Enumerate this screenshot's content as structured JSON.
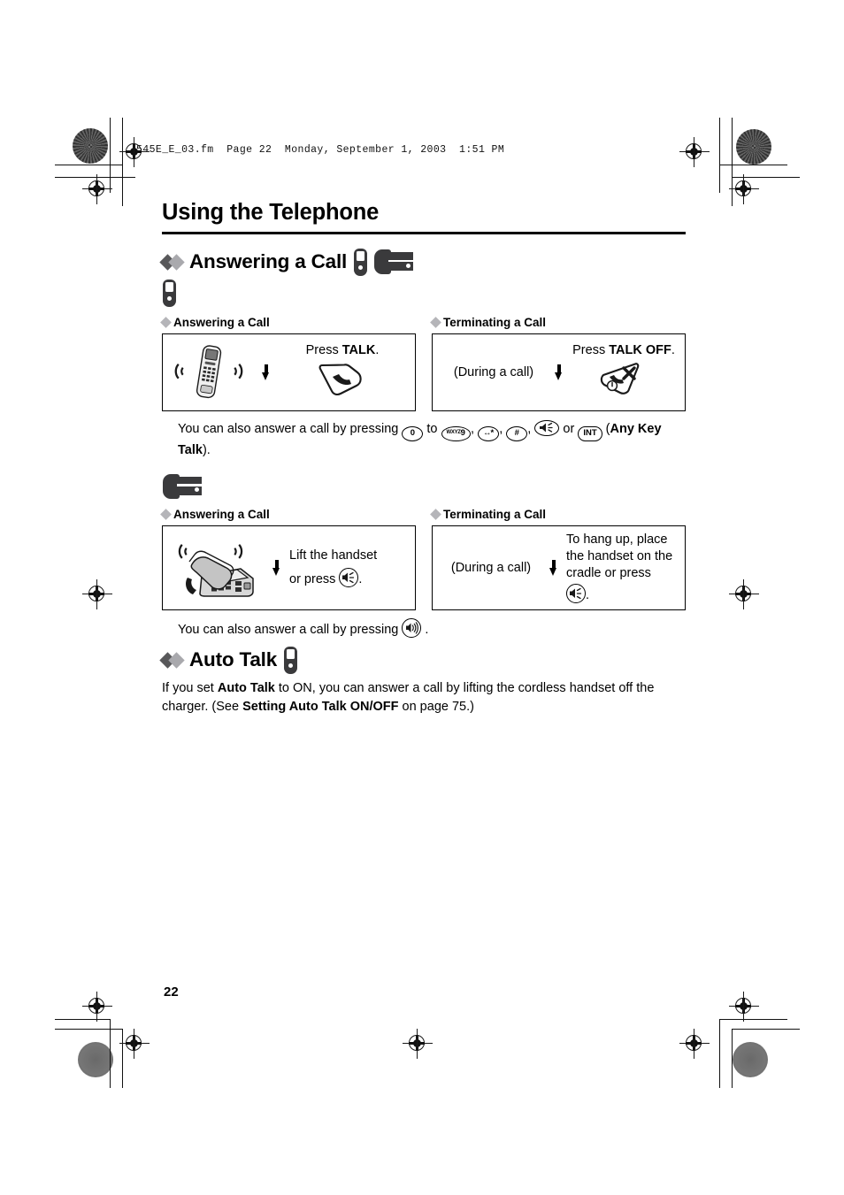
{
  "print_marks": {
    "file_header": "545E_E_03.fm  Page 22  Monday, September 1, 2003  1:51 PM"
  },
  "page": {
    "title": "Using the Telephone",
    "number": "22"
  },
  "sections": [
    {
      "id": "answering-a-call",
      "heading": "Answering a Call",
      "heading_icons": [
        "handset-icon",
        "base-unit-icon"
      ],
      "device_groups": [
        {
          "device_icon": "handset-icon",
          "columns": [
            {
              "sub_heading": "Answering a Call",
              "box": {
                "illustration": "ringing-cordless-handset-illustration",
                "left_label": "",
                "arrow": "down-arrow-icon",
                "instruction_prefix": "Press ",
                "instruction_bold": "TALK",
                "instruction_suffix": ".",
                "button_icon": "talk-button-icon"
              }
            },
            {
              "sub_heading": "Terminating a Call",
              "box": {
                "illustration": "",
                "left_label": "(During a call)",
                "arrow": "down-arrow-icon",
                "instruction_prefix": "Press ",
                "instruction_bold": "TALK OFF",
                "instruction_suffix": ".",
                "button_icon": "talk-off-button-icon"
              }
            }
          ],
          "note": {
            "prefix": "You can also answer a call by pressing ",
            "key_zero": "0",
            "mid_to": " to ",
            "key_nine_sup": "WXYZ",
            "key_nine": "9",
            "sep1": ", ",
            "key_star": "*",
            "sep2": ", ",
            "key_hash": "#",
            "sep3": ", ",
            "key_speaker": "speakerphone-key-icon",
            "sep4": " or ",
            "key_int": "INT",
            "suffix_open": " (",
            "suffix_bold": "Any Key Talk",
            "suffix_close": ")."
          }
        },
        {
          "device_icon": "base-unit-icon",
          "columns": [
            {
              "sub_heading": "Answering a Call",
              "box": {
                "illustration": "ringing-corded-base-unit-illustration",
                "left_label": "",
                "arrow": "down-arrow-icon",
                "instruction_line1": "Lift the handset",
                "instruction_line2_prefix": "or press ",
                "instruction_line2_suffix": ".",
                "button_icon": "speakerphone-key-icon"
              }
            },
            {
              "sub_heading": "Terminating a Call",
              "box": {
                "illustration": "",
                "left_label": "(During a call)",
                "arrow": "down-arrow-icon",
                "instruction_line1": "To hang up, place",
                "instruction_line2": "the handset on the",
                "instruction_line3": "cradle or press",
                "instruction_line4_suffix": ".",
                "button_icon": "speakerphone-key-icon"
              }
            }
          ],
          "note": {
            "prefix": "You can also answer a call by pressing ",
            "key_ringer": "handsfree-key-icon",
            "suffix": " ."
          }
        }
      ]
    },
    {
      "id": "auto-talk",
      "heading": "Auto Talk",
      "heading_icons": [
        "handset-icon"
      ],
      "body": {
        "part1": "If you set ",
        "bold1": "Auto Talk",
        "part2": " to ON, you can answer a call by lifting the cordless handset off the charger. (See ",
        "bold2": "Setting Auto Talk ON/OFF",
        "part3": " on page 75.)"
      }
    }
  ],
  "colors": {
    "diamond_dark": "#58585a",
    "diamond_light": "#a9a9ad",
    "device_icon": "#3a3a3c",
    "rule": "#000000"
  }
}
